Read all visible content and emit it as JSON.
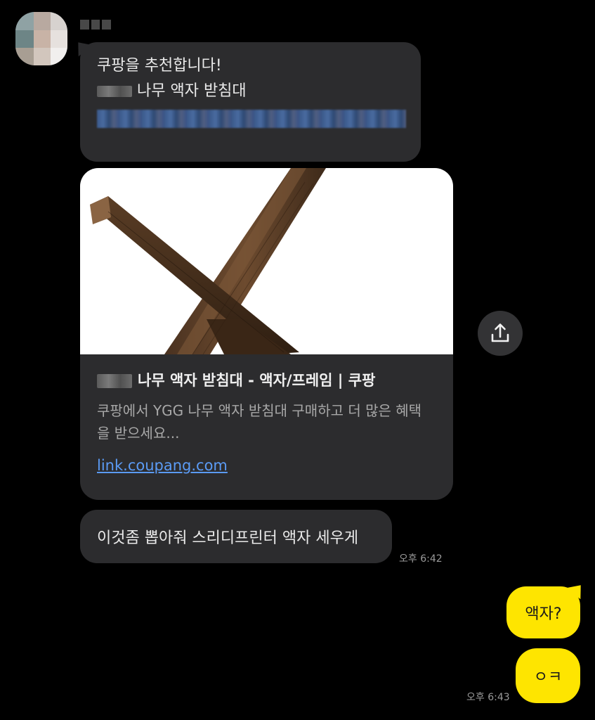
{
  "colors": {
    "background": "#000000",
    "incoming_bubble": "#2c2c2e",
    "outgoing_bubble": "#fee500",
    "link": "#5b9bf5"
  },
  "sender": {
    "avatar_icon": "avatar-icon"
  },
  "message1": {
    "line1": "쿠팡을 추천합니다!",
    "line2_suffix": "나무 액자 받침대"
  },
  "link_card": {
    "title_suffix": "나무 액자 받침대 - 액자/프레임 | 쿠팡",
    "description": "쿠팡에서 YGG 나무 액자 받침대 구매하고 더 많은 혜택을 받으세요...",
    "domain": "link.coupang.com"
  },
  "share_button": {
    "icon": "share-icon"
  },
  "message2": {
    "text": "이것좀 뽑아줘 스리디프린터 액자 세우게",
    "time": "오후 6:42"
  },
  "my_messages": [
    {
      "text": "액자?"
    },
    {
      "text": "ㅇㅋ",
      "time": "오후 6:43"
    }
  ]
}
